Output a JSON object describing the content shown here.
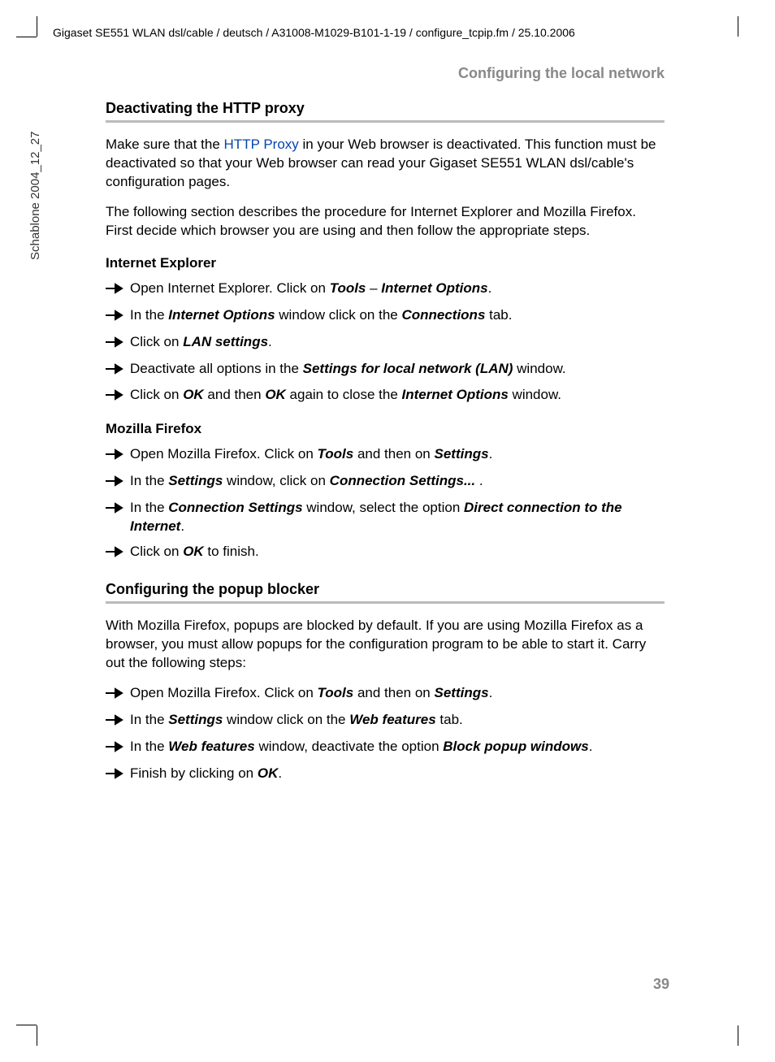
{
  "header_path": "Gigaset SE551 WLAN dsl/cable / deutsch / A31008-M1029-B101-1-19 / configure_tcpip.fm / 25.10.2006",
  "side_label": "Schablone 2004_12_27",
  "running_head": "Configuring the local network",
  "section1": {
    "title": "Deactivating the HTTP proxy",
    "para1_a": "Make sure that the ",
    "para1_link": "HTTP Proxy",
    "para1_b": " in your Web browser is deactivated. This function must be deactivated so that your Web browser can read your Gigaset SE551 WLAN dsl/cable's configuration pages.",
    "para2": "The following section describes the procedure for Internet Explorer and Mozilla Firefox. First decide which browser you are using and then follow the appropriate steps.",
    "ie": {
      "heading": "Internet Explorer",
      "s1a": "Open Internet Explorer. Click on ",
      "s1b": "Tools",
      "s1c": " – ",
      "s1d": "Internet Options",
      "s1e": ".",
      "s2a": "In the ",
      "s2b": "Internet Options",
      "s2c": " window click on the ",
      "s2d": "Connections",
      "s2e": " tab.",
      "s3a": "Click on ",
      "s3b": "LAN settings",
      "s3c": ".",
      "s4a": "Deactivate all options in the ",
      "s4b": "Settings for local network (LAN)",
      "s4c": " window.",
      "s5a": "Click on ",
      "s5b": "OK",
      "s5c": " and then ",
      "s5d": "OK",
      "s5e": " again to close the ",
      "s5f": "Internet Options",
      "s5g": " window."
    },
    "ff": {
      "heading": "Mozilla Firefox",
      "s1a": "Open Mozilla Firefox. Click on ",
      "s1b": "Tools",
      "s1c": " and then on ",
      "s1d": "Settings",
      "s1e": ".",
      "s2a": "In the ",
      "s2b": "Settings",
      "s2c": " window, click on ",
      "s2d": "Connection Settings...",
      "s2e": " .",
      "s3a": "In the ",
      "s3b": "Connection Settings",
      "s3c": " window, select the option ",
      "s3d": "Direct connection to the Internet",
      "s3e": ".",
      "s4a": "Click on ",
      "s4b": "OK",
      "s4c": " to finish."
    }
  },
  "section2": {
    "title": "Configuring the popup blocker",
    "para1": "With Mozilla Firefox, popups are blocked by default. If you are using Mozilla Firefox as a browser, you must allow popups for the configuration program to be able to start it. Carry out the following steps:",
    "s1a": "Open Mozilla Firefox. Click on ",
    "s1b": "Tools",
    "s1c": " and then on ",
    "s1d": "Settings",
    "s1e": ".",
    "s2a": "In the ",
    "s2b": "Settings",
    "s2c": " window click on the ",
    "s2d": "Web features",
    "s2e": " tab.",
    "s3a": "In the ",
    "s3b": "Web features",
    "s3c": " window, deactivate the option ",
    "s3d": "Block popup windows",
    "s3e": ".",
    "s4a": "Finish by clicking on ",
    "s4b": "OK",
    "s4c": "."
  },
  "page_number": "39"
}
